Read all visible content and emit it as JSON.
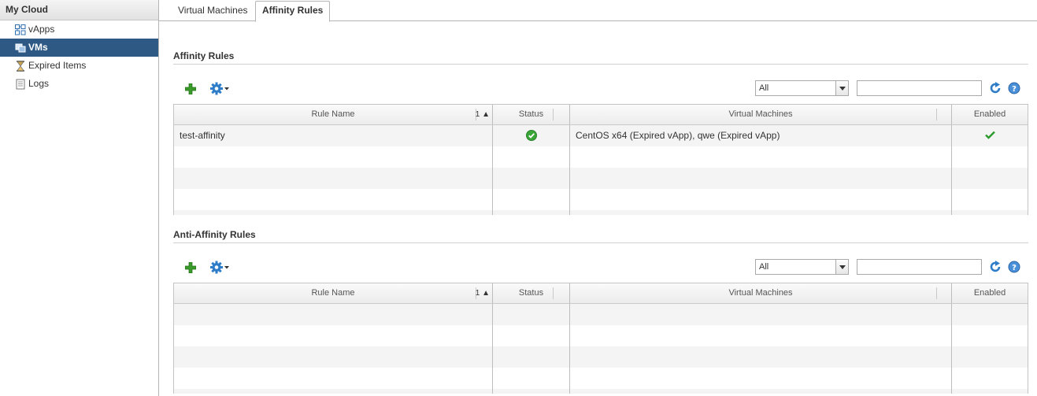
{
  "sidebar": {
    "title": "My Cloud",
    "items": [
      {
        "label": "vApps",
        "icon": "vapps-icon"
      },
      {
        "label": "VMs",
        "icon": "vm-icon",
        "selected": true
      },
      {
        "label": "Expired Items",
        "icon": "hourglass-icon"
      },
      {
        "label": "Logs",
        "icon": "log-icon"
      }
    ]
  },
  "tabs": [
    {
      "label": "Virtual Machines",
      "active": false
    },
    {
      "label": "Affinity Rules",
      "active": true
    }
  ],
  "affinity": {
    "title": "Affinity Rules",
    "filter_value": "All",
    "search_value": "",
    "columns": {
      "rule_name": "Rule Name",
      "sort_indicator": "1 ▲",
      "status": "Status",
      "virtual_machines": "Virtual Machines",
      "enabled": "Enabled"
    },
    "rows": [
      {
        "rule_name": "test-affinity",
        "status": "ok",
        "virtual_machines": "CentOS x64 (Expired vApp), qwe (Expired vApp)",
        "enabled": true
      }
    ]
  },
  "anti_affinity": {
    "title": "Anti-Affinity Rules",
    "filter_value": "All",
    "search_value": "",
    "columns": {
      "rule_name": "Rule Name",
      "sort_indicator": "1 ▲",
      "status": "Status",
      "virtual_machines": "Virtual Machines",
      "enabled": "Enabled"
    },
    "rows": []
  },
  "colors": {
    "selected_bg": "#2e5985",
    "add_green": "#3a9a2a",
    "status_ok": "#3aa639",
    "icon_blue": "#2f7dc8"
  }
}
